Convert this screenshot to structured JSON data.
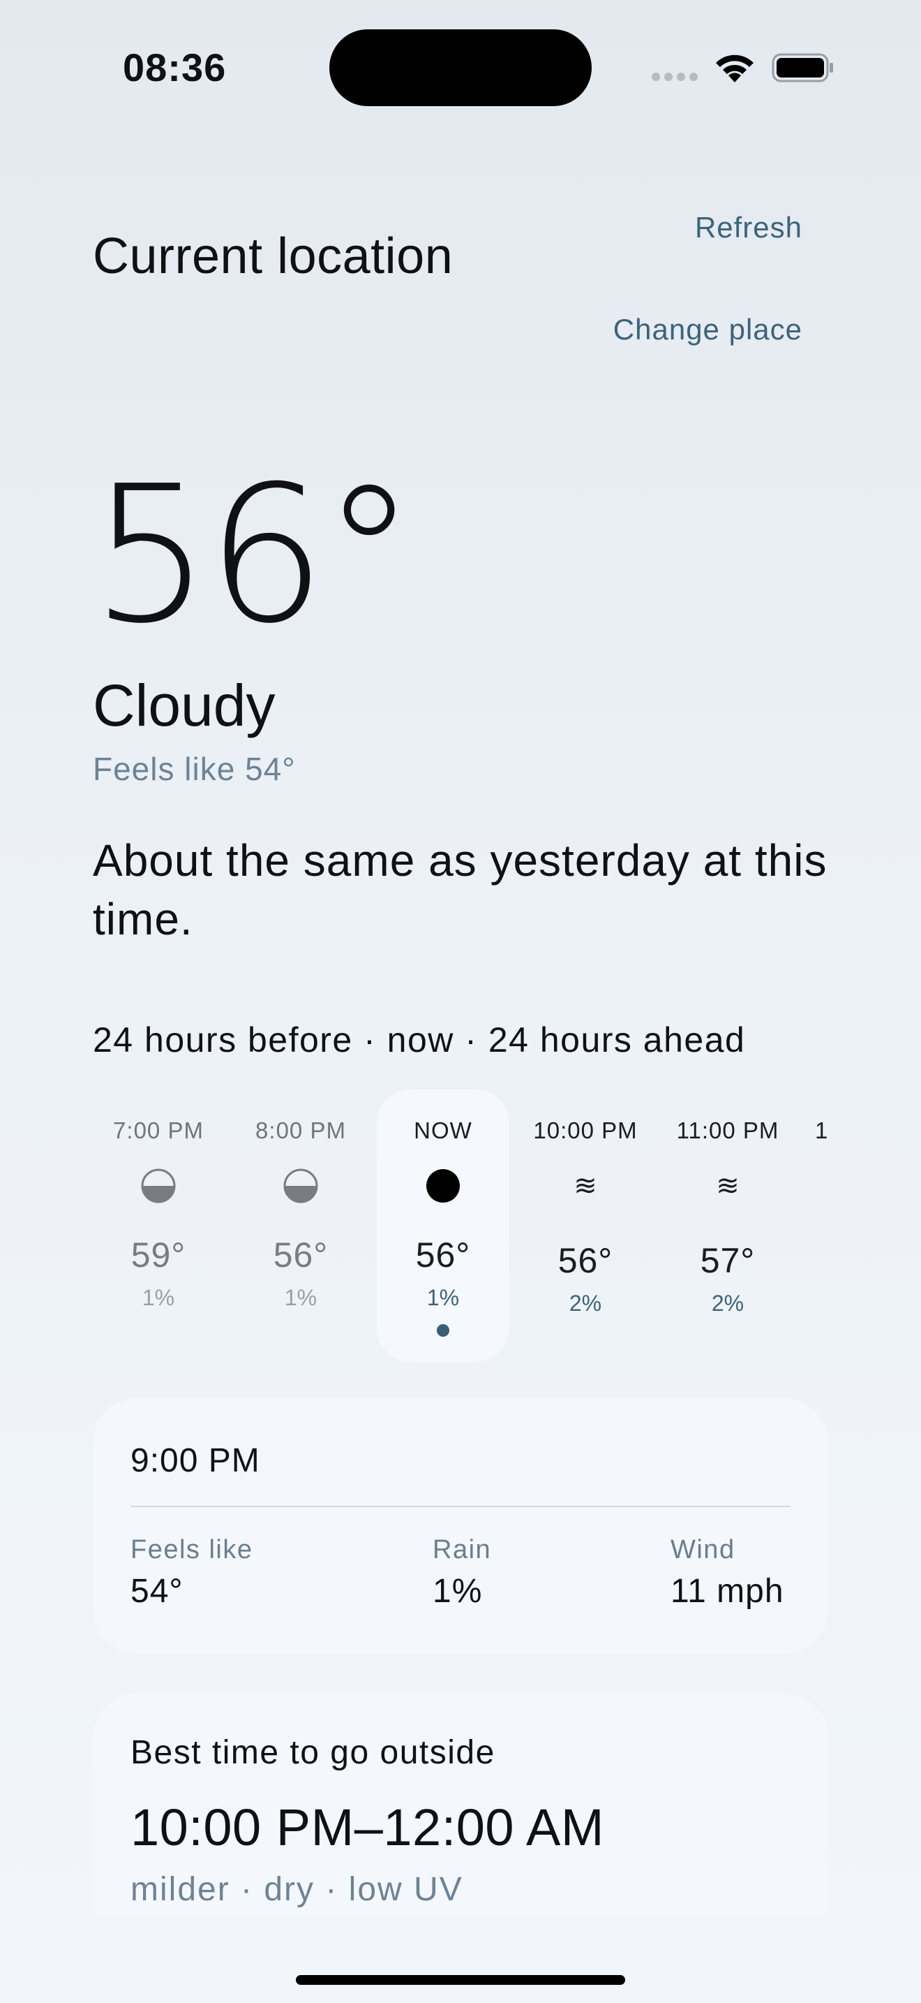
{
  "status_bar": {
    "time": "08:36"
  },
  "header": {
    "title": "Current location",
    "refresh_label": "Refresh",
    "change_place_label": "Change place"
  },
  "current": {
    "temperature": "56°",
    "condition": "Cloudy",
    "feels_like": "Feels like 54°",
    "comparison": "About the same as yesterday at this time."
  },
  "timeline": {
    "caption": "24 hours before · now · 24 hours ahead",
    "hours": [
      {
        "label": "7:00 PM",
        "icon": "half-cloud-icon",
        "temp": "59°",
        "rain": "1%",
        "state": "past"
      },
      {
        "label": "8:00 PM",
        "icon": "half-cloud-icon",
        "temp": "56°",
        "rain": "1%",
        "state": "past"
      },
      {
        "label": "NOW",
        "icon": "cloud-filled-icon",
        "temp": "56°",
        "rain": "1%",
        "state": "now"
      },
      {
        "label": "10:00 PM",
        "icon": "wind-icon",
        "glyph": "≋",
        "temp": "56°",
        "rain": "2%",
        "state": "future"
      },
      {
        "label": "11:00 PM",
        "icon": "wind-icon",
        "glyph": "≋",
        "temp": "57°",
        "rain": "2%",
        "state": "future"
      },
      {
        "label": "1",
        "state": "partial"
      }
    ]
  },
  "detail": {
    "time": "9:00 PM",
    "metrics": [
      {
        "label": "Feels like",
        "value": "54°"
      },
      {
        "label": "Rain",
        "value": "1%"
      },
      {
        "label": "Wind",
        "value": "11 mph"
      }
    ]
  },
  "best_time": {
    "title": "Best time to go outside",
    "range": "10:00 PM–12:00 AM",
    "description": "milder · dry · low UV"
  },
  "colors": {
    "accent": "#3d6379",
    "background": "#e3e9ef",
    "card": "#f4f7fb"
  }
}
